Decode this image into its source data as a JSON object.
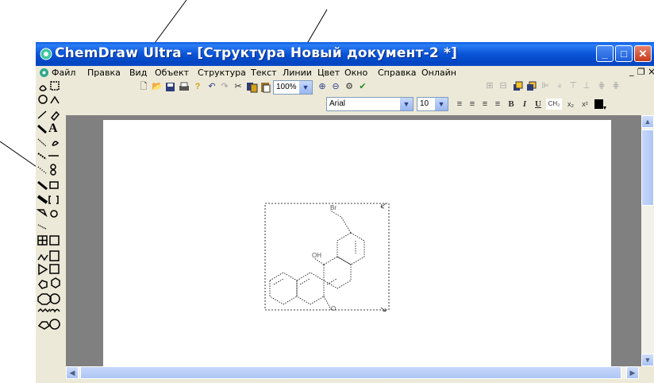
{
  "window": {
    "title": "ChemDraw Ultra - [Структура Новый документ-2 *]",
    "accent_color": "#0a54d8",
    "controls": {
      "minimize": "_",
      "maximize": "□",
      "close": "✕"
    }
  },
  "menu": {
    "items": [
      "Файл",
      "Правка",
      "Вид",
      "Объект",
      "Структура",
      "Текст",
      "Линии",
      "Цвет",
      "Окно",
      "Справка",
      "Онлайн"
    ],
    "doc_controls": {
      "minimize": "_",
      "restore": "❐",
      "close": "×"
    }
  },
  "toolbar": {
    "zoom": "100%",
    "font": "Arial",
    "size": "10",
    "bold": "B",
    "italic": "I",
    "underline": "U",
    "formula": "CH₂",
    "subscript": "x₂",
    "superscript": "x²"
  },
  "drawing": {
    "labels": [
      "Br",
      "OH",
      "O"
    ]
  }
}
